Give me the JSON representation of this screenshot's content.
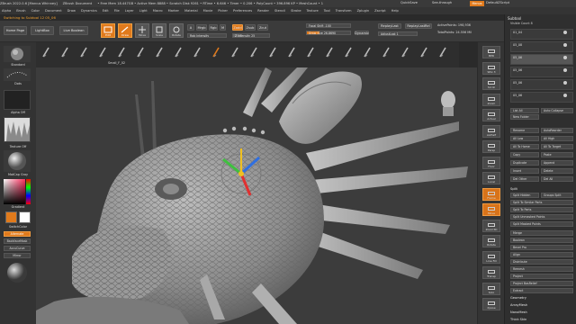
{
  "title_bar": {
    "items": [
      "ZBrush 2022.0.6 [Marcus Whinney]",
      "ZBrush Document",
      "• Free Mem 18.447GB • Active Mem 8888 • Scratch Disk 9261 • RTime • 6.646 • Timer • 0.206 • PolyCount • 396.896 KP • MeshCount • 1"
    ],
    "quicksave": "QuickSave",
    "seethrough": "See-through",
    "menus": "Menus",
    "script": "DefaultZScript"
  },
  "menu_bar": [
    "Alpha",
    "Brush",
    "Color",
    "Document",
    "Draw",
    "Dynamics",
    "Edit",
    "File",
    "Layer",
    "Light",
    "Macro",
    "Marker",
    "Material",
    "Movie",
    "Picker",
    "Preferences",
    "Render",
    "Stencil",
    "Stroke",
    "Texture",
    "Tool",
    "Transform",
    "Zplugin",
    "Zscript",
    "Help"
  ],
  "message": "Switching to Subtool 12   05_06",
  "toolbar": {
    "home_page": "Home Page",
    "lightbox": "LightBox",
    "live_boolean": "Live Boolean",
    "edit": "Edit",
    "draw": "Draw",
    "move": "Move",
    "scale": "Scale",
    "rotate": "Rotate",
    "a_label": "A",
    "mrgb": "Mrgb",
    "rgb": "Rgb",
    "m": "M",
    "zadd": "Zadd",
    "zsub": "Zsub",
    "zcut": "Zcut",
    "rgb_intensity": "Rgb Intensity",
    "z_intensity": "Z Intensity 25",
    "focal_shift": "Focal Shift -100",
    "draw_size": "Draw Size 26.8690",
    "dynamic": "Dynamic",
    "replay_last": "ReplayLast",
    "replay_last_rel": "ReplayLastRel",
    "adjust_last": "AdjustLast 1",
    "active_points": "ActivePoints: 198,936",
    "total_points": "TotalPoints: 24.556 Mil"
  },
  "brush_strip": {
    "label": "Small_F_02",
    "count": 22
  },
  "left_panel": {
    "standard": "Standard",
    "dots": "Dots",
    "alpha_off": "Alpha Off",
    "texture_off": "Texture Off",
    "material": "MatCap Gray",
    "gradient": "Gradient",
    "switch_color": "SwitchColor",
    "alternate": "Alternate",
    "backface_mask": "BackfaceMask",
    "accu_curve": "AccuCurve",
    "mirror": "Mirror",
    "main_color": "#e07a1c",
    "secondary_color": "#ffffff"
  },
  "right_strip": [
    "BPR",
    "SPix 3",
    "Scroll",
    "Zoom",
    "Actual",
    "AAHalf",
    "Persp",
    "Floor",
    "Local",
    "Frame",
    "Move",
    "Zoom3D",
    "Rotate",
    "Line Fill",
    "Transp",
    "Solo",
    "Xpose"
  ],
  "subtool": {
    "header": "Subtool",
    "visible_count": "Visible Count 8",
    "items": [
      "01_04",
      "05_08",
      "05_06",
      "05_06",
      "05_06",
      "05_06"
    ],
    "selected_index": 2,
    "list_all": "List All",
    "new_folder": "New Folder",
    "auto_collapse": "Auto Collapse",
    "buttons": [
      "Rename",
      "AutoReorder",
      "All Low",
      "All High",
      "All To Home",
      "All To Target",
      "Copy",
      "Paste",
      "Duplicate",
      "Append",
      "Insert",
      "Delete",
      "Del Other",
      "Del All"
    ],
    "split_header": "Split",
    "split_hidden": "Split Hidden",
    "groups_split": "Groups Split",
    "split_items": [
      "Split To Similar Parts",
      "Split To Parts",
      "Split Unmasked Points",
      "Split Masked Points"
    ],
    "merge_items": [
      "Merge",
      "Boolean",
      "Bevel Pro",
      "Align",
      "Distribute",
      "Remesh",
      "Project",
      "Project BasRelief",
      "Extract"
    ],
    "bottom_items": [
      "Geometry",
      "ArrayMesh",
      "NanoMesh",
      "Thick Skin"
    ]
  },
  "colors": {
    "accent": "#e07a1c",
    "panel": "#333333",
    "viewport": "#3c3c3c"
  }
}
